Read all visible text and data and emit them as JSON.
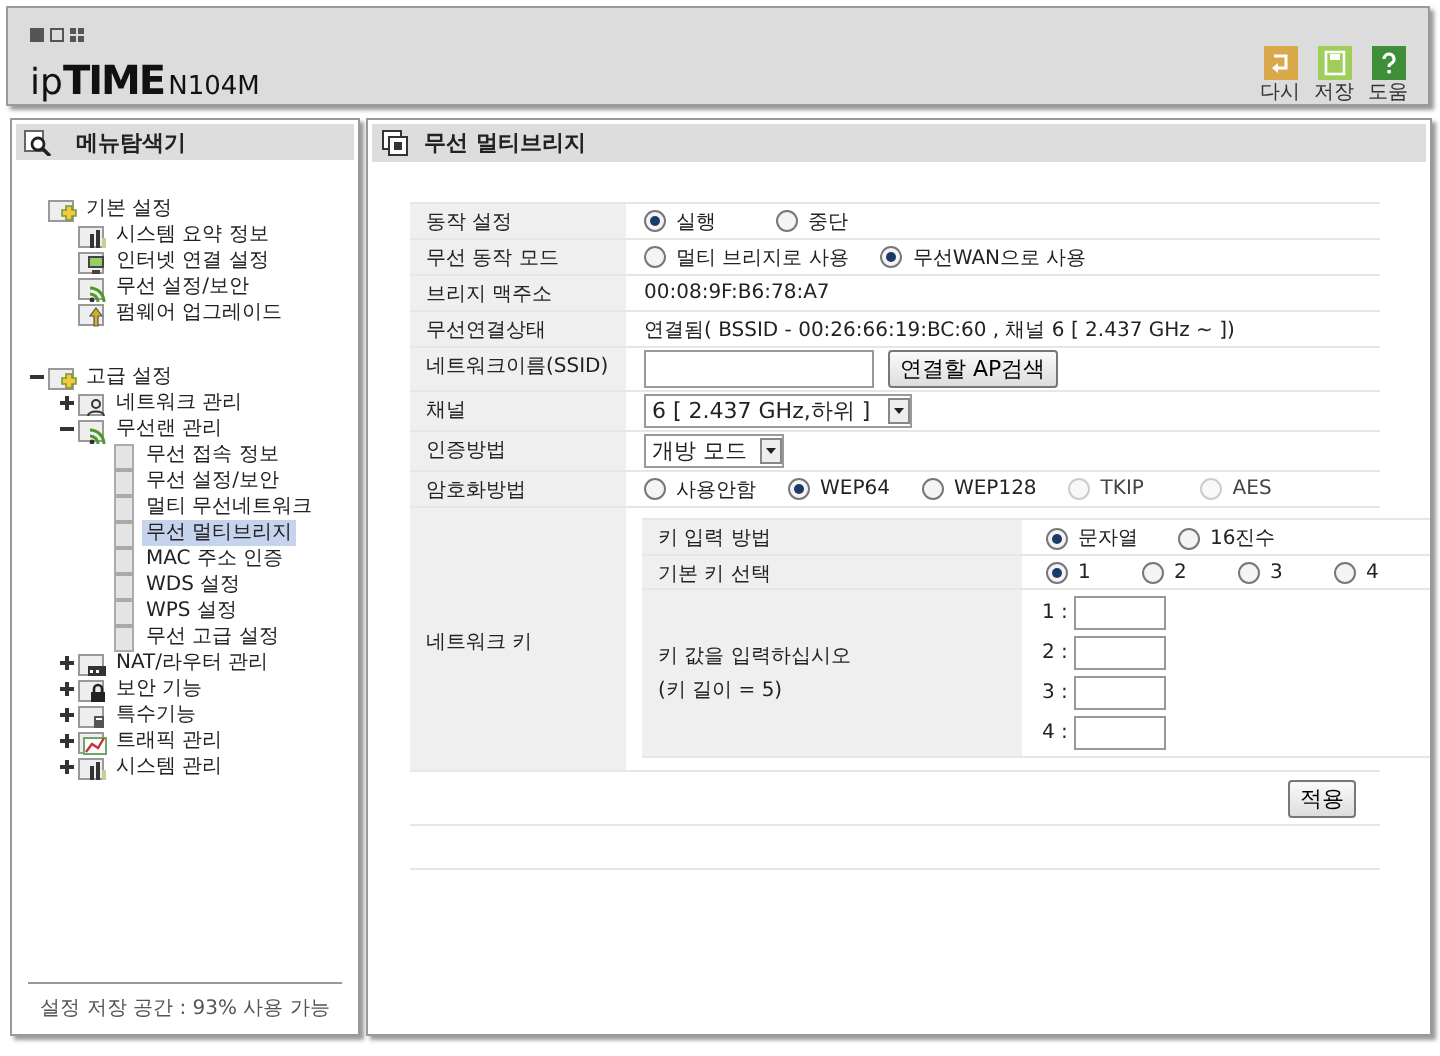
{
  "header": {
    "logo": "ipTIME",
    "model": "N104M",
    "toolbar": [
      {
        "kind": "undo",
        "label": "다시"
      },
      {
        "kind": "save",
        "label": "저장"
      },
      {
        "kind": "help",
        "label": "도움"
      }
    ]
  },
  "sidebar": {
    "title": "메뉴탐색기",
    "tree": [
      {
        "label": "기본 설정",
        "kind": "folder",
        "selected": false,
        "children": [
          {
            "label": "시스템 요약 정보",
            "kind": "chart",
            "selected": false
          },
          {
            "label": "인터넷 연결 설정",
            "kind": "monitor",
            "selected": false
          },
          {
            "label": "무선 설정/보안",
            "kind": "wifi",
            "selected": false
          },
          {
            "label": "펌웨어 업그레이드",
            "kind": "upgrade",
            "selected": false
          }
        ]
      },
      {
        "label": "고급 설정",
        "kind": "folder",
        "selected": false,
        "expanded": true,
        "children": [
          {
            "label": "네트워크 관리",
            "kind": "network",
            "selected": false,
            "expanded": false
          },
          {
            "label": "무선랜 관리",
            "kind": "wifi",
            "selected": false,
            "expanded": true,
            "children": [
              {
                "label": "무선 접속 정보",
                "kind": "page",
                "selected": false
              },
              {
                "label": "무선 설정/보안",
                "kind": "page",
                "selected": false
              },
              {
                "label": "멀티 무선네트워크",
                "kind": "page",
                "selected": false
              },
              {
                "label": "무선 멀티브리지",
                "kind": "page",
                "selected": true
              },
              {
                "label": "MAC 주소 인증",
                "kind": "page",
                "selected": false
              },
              {
                "label": "WDS 설정",
                "kind": "page",
                "selected": false
              },
              {
                "label": "WPS 설정",
                "kind": "page",
                "selected": false
              },
              {
                "label": "무선 고급 설정",
                "kind": "page",
                "selected": false
              }
            ]
          },
          {
            "label": "NAT/라우터 관리",
            "kind": "router",
            "selected": false,
            "expanded": false
          },
          {
            "label": "보안 기능",
            "kind": "lock",
            "selected": false,
            "expanded": false
          },
          {
            "label": "특수기능",
            "kind": "special",
            "selected": false,
            "expanded": false
          },
          {
            "label": "트래픽 관리",
            "kind": "traffic",
            "selected": false,
            "expanded": false
          },
          {
            "label": "시스템 관리",
            "kind": "chart",
            "selected": false,
            "expanded": false
          }
        ]
      }
    ],
    "footer": "설정 저장 공간 : 93% 사용 가능"
  },
  "panel": {
    "title": "무선 멀티브리지",
    "rows": [
      {
        "kind": "radio",
        "label": "동작 설정",
        "options": [
          {
            "label": "실행",
            "selected": true,
            "disabled": false
          },
          {
            "label": "중단",
            "selected": false,
            "disabled": false
          }
        ]
      },
      {
        "kind": "radio",
        "label": "무선 동작 모드",
        "options": [
          {
            "label": "멀티 브리지로 사용",
            "selected": false,
            "disabled": false
          },
          {
            "label": "무선WAN으로 사용",
            "selected": true,
            "disabled": false
          }
        ]
      },
      {
        "kind": "text",
        "label": "브리지 맥주소",
        "value": "00:08:9F:B6:78:A7"
      },
      {
        "kind": "text",
        "label": "무선연결상태",
        "value": "연결됨( BSSID - 00:26:66:19:BC:60 , 채널 6 [ 2.437 GHz ~ ])"
      },
      {
        "kind": "input",
        "label": "네트워크이름(SSID)",
        "button": "연결할 AP검색"
      },
      {
        "kind": "select",
        "label": "채널",
        "value": "6 [ 2.437 GHz,하위 ]"
      },
      {
        "kind": "select",
        "label": "인증방법",
        "value": "개방 모드"
      },
      {
        "kind": "radio",
        "label": "암호화방법",
        "options": [
          {
            "label": "사용안함",
            "selected": false,
            "disabled": false
          },
          {
            "label": "WEP64",
            "selected": true,
            "disabled": false
          },
          {
            "label": "WEP128",
            "selected": false,
            "disabled": false
          },
          {
            "label": "TKIP",
            "selected": false,
            "disabled": true
          },
          {
            "label": "AES",
            "selected": false,
            "disabled": true
          }
        ]
      },
      {
        "kind": "key",
        "label": "네트워크 키",
        "method": {
          "label": "키 입력 방법",
          "options": [
            {
              "label": "문자열",
              "selected": true,
              "disabled": false
            },
            {
              "label": "16진수",
              "selected": false,
              "disabled": false
            }
          ]
        },
        "default_key": {
          "label": "기본 키 선택",
          "options": [
            {
              "label": "1",
              "selected": true,
              "disabled": false
            },
            {
              "label": "2",
              "selected": false,
              "disabled": false
            },
            {
              "label": "3",
              "selected": false,
              "disabled": false
            },
            {
              "label": "4",
              "selected": false,
              "disabled": false
            }
          ]
        },
        "keys": {
          "label": "키 값을 입력하십시오",
          "hint": "(키 길이 = 5)",
          "fields": [
            {
              "label": "1 :"
            },
            {
              "label": "2 :"
            },
            {
              "label": "3 :"
            },
            {
              "label": "4 :"
            }
          ]
        }
      }
    ],
    "apply": "적용"
  }
}
